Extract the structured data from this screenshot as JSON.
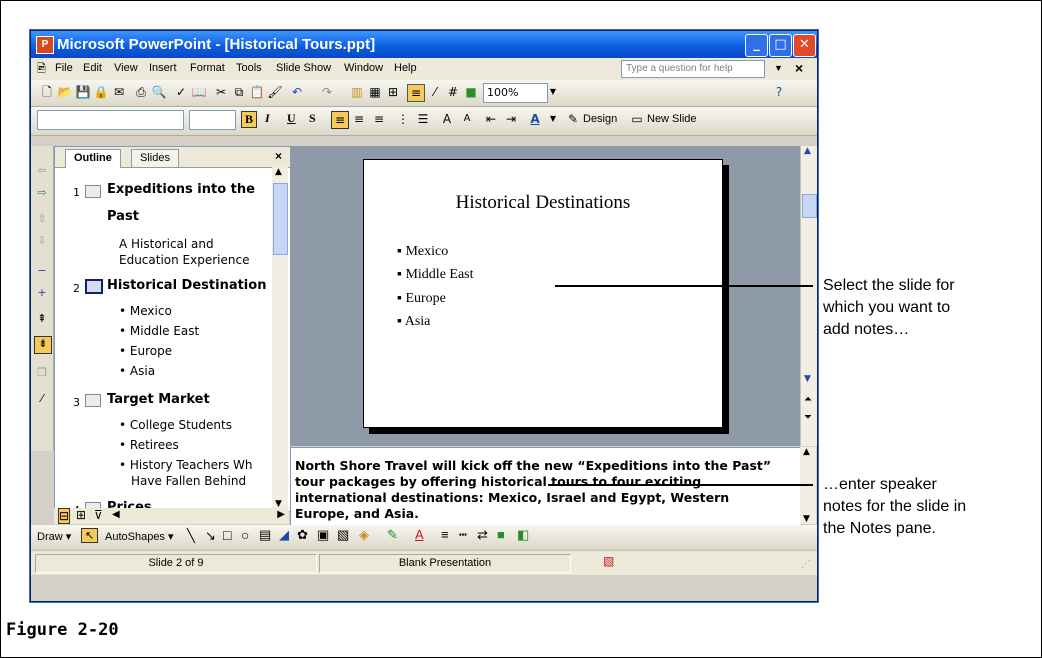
{
  "window": {
    "title": "Microsoft PowerPoint - [Historical Tours.ppt]",
    "min_label": "_",
    "max_label": "□",
    "close_label": "✕"
  },
  "menu": {
    "items": [
      "File",
      "Edit",
      "View",
      "Insert",
      "Format",
      "Tools",
      "Slide Show",
      "Window",
      "Help"
    ],
    "help_placeholder": "Type a question for help",
    "close_label": "×"
  },
  "toolbar": {
    "zoom": "100%",
    "bold": "B",
    "italic": "I",
    "underline": "U",
    "shadow": "S",
    "design_label": "Design",
    "new_slide_label": "New Slide"
  },
  "outline_pane": {
    "tabs": [
      "Outline",
      "Slides"
    ],
    "close_label": "×",
    "slides": [
      {
        "num": "1",
        "title": "Expeditions into the",
        "title2": "Past",
        "lines": [
          "A Historical and",
          "Education Experience"
        ]
      },
      {
        "num": "2",
        "title": "Historical Destinations",
        "bullets": [
          "• Mexico",
          "• Middle East",
          "• Europe",
          "• Asia"
        ]
      },
      {
        "num": "3",
        "title": "Target Market",
        "bullets": [
          "• College Students",
          "• Retirees",
          "• History Teachers Wh",
          "Have Fallen Behind"
        ]
      },
      {
        "num": "4",
        "title": "Prices"
      }
    ]
  },
  "slide": {
    "title": "Historical Destinations",
    "bullets": [
      "Mexico",
      "Middle East",
      "Europe",
      "Asia"
    ]
  },
  "notes": {
    "lines": [
      "North Shore Travel will kick off the new “Expeditions into the Past”",
      "tour packages by offering historical tours to four exciting",
      "international destinations: Mexico, Israel and Egypt, Western",
      "Europe, and Asia."
    ]
  },
  "drawing_toolbar": {
    "draw_label": "Draw ▾",
    "autoshapes_label": "AutoShapes ▾"
  },
  "status": {
    "slide": "Slide 2 of 9",
    "design": "Blank Presentation"
  },
  "callouts": {
    "top": [
      "Select the slide for",
      "which you want to",
      "add notes…"
    ],
    "bottom": [
      "…enter speaker",
      "notes for the slide in",
      "the Notes pane."
    ]
  },
  "caption": "Figure 2-20"
}
